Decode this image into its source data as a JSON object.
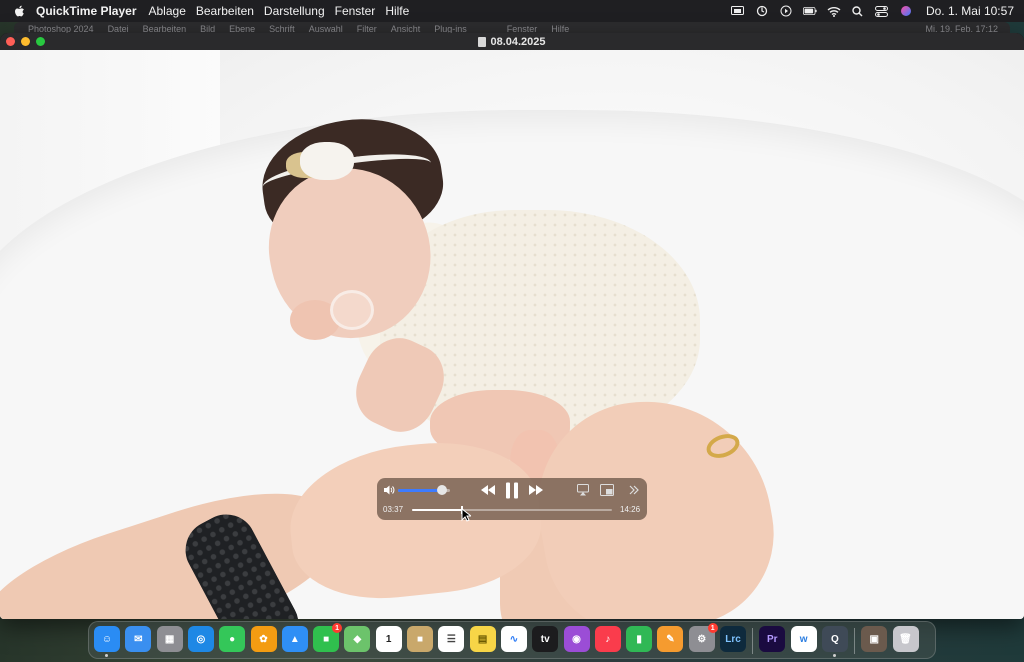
{
  "menubar": {
    "app_name": "QuickTime Player",
    "menus": [
      "Ablage",
      "Bearbeiten",
      "Darstellung",
      "Fenster",
      "Hilfe"
    ],
    "clock": "Do. 1. Mai  10:57"
  },
  "background_window": {
    "app_name": "Photoshop 2024",
    "menus": [
      "Datei",
      "Bearbeiten",
      "Bild",
      "Ebene",
      "Schrift",
      "Auswahl",
      "Filter",
      "Ansicht",
      "Plug-ins"
    ],
    "right_menus": [
      "Fenster",
      "Hilfe"
    ],
    "clock": "Mi. 19. Feb. 17:12"
  },
  "window": {
    "title": "08.04.2025"
  },
  "player": {
    "current_time": "03:37",
    "duration": "14:26",
    "progress_fraction": 0.25,
    "volume_fraction": 0.85
  },
  "dock": {
    "items": [
      {
        "name": "Finder",
        "icon": "finder-icon",
        "color": "#2a8cf4",
        "glyph": "☺",
        "running": true
      },
      {
        "name": "Mail",
        "icon": "mail-icon",
        "color": "#3a8ff0",
        "glyph": "✉"
      },
      {
        "name": "Launchpad",
        "icon": "launchpad-icon",
        "color": "#8e8e93",
        "glyph": "▦"
      },
      {
        "name": "Safari",
        "icon": "safari-icon",
        "color": "#1e88e5",
        "glyph": "◎"
      },
      {
        "name": "Messages",
        "icon": "messages-icon",
        "color": "#34c759",
        "glyph": "●"
      },
      {
        "name": "Photos",
        "icon": "photos-icon",
        "color": "#f39c12",
        "glyph": "✿"
      },
      {
        "name": "Keynote",
        "icon": "keynote-icon",
        "color": "#2f8ff5",
        "glyph": "▲"
      },
      {
        "name": "FaceTime",
        "icon": "facetime-icon",
        "color": "#30c04e",
        "glyph": "■",
        "badge": "1"
      },
      {
        "name": "Maps",
        "icon": "maps-icon",
        "color": "#6cc36b",
        "glyph": "◆"
      },
      {
        "name": "Calendar",
        "icon": "calendar-icon",
        "color": "#ffffff",
        "glyph": "1",
        "text_color": "#222"
      },
      {
        "name": "Archive",
        "icon": "archive-icon",
        "color": "#c9a86b",
        "glyph": "■"
      },
      {
        "name": "Reminders",
        "icon": "reminders-icon",
        "color": "#ffffff",
        "glyph": "☰",
        "text_color": "#444"
      },
      {
        "name": "Notes",
        "icon": "notes-icon",
        "color": "#f7d547",
        "glyph": "▤",
        "text_color": "#6b5a00"
      },
      {
        "name": "Freeform",
        "icon": "freeform-icon",
        "color": "#ffffff",
        "glyph": "∿",
        "text_color": "#2f7df6"
      },
      {
        "name": "Apple TV",
        "icon": "appletv-icon",
        "color": "#1c1c1e",
        "glyph": "tv"
      },
      {
        "name": "Podcasts",
        "icon": "podcasts-icon",
        "color": "#9b4dd6",
        "glyph": "◉"
      },
      {
        "name": "Music",
        "icon": "music-icon",
        "color": "#fa3c4c",
        "glyph": "♪"
      },
      {
        "name": "Numbers",
        "icon": "numbers-icon",
        "color": "#30b855",
        "glyph": "▮"
      },
      {
        "name": "Pages",
        "icon": "pages-icon",
        "color": "#f59b2f",
        "glyph": "✎"
      },
      {
        "name": "System Settings",
        "icon": "settings-icon",
        "color": "#8e8e93",
        "glyph": "⚙",
        "badge": "1"
      },
      {
        "name": "Lightroom Classic",
        "icon": "lightroom-icon",
        "color": "#0e2a3d",
        "glyph": "Lrc",
        "text_color": "#7fc3ff"
      },
      {
        "name": "Premiere Pro",
        "icon": "premiere-icon",
        "color": "#1a0b40",
        "glyph": "Pr",
        "text_color": "#b59bff"
      },
      {
        "name": "Wallet App",
        "icon": "w-app-icon",
        "color": "#ffffff",
        "glyph": "w",
        "text_color": "#2a7de1"
      },
      {
        "name": "QuickTime Player",
        "icon": "quicktime-icon",
        "color": "#3f4a57",
        "glyph": "Q",
        "running": true
      },
      {
        "name": "Photo Stack",
        "icon": "photo-stack-icon",
        "color": "#6b5a4d",
        "glyph": "▣"
      },
      {
        "name": "Trash",
        "icon": "trash-icon",
        "color": "#c7c7cc",
        "glyph": "🗑"
      }
    ]
  }
}
